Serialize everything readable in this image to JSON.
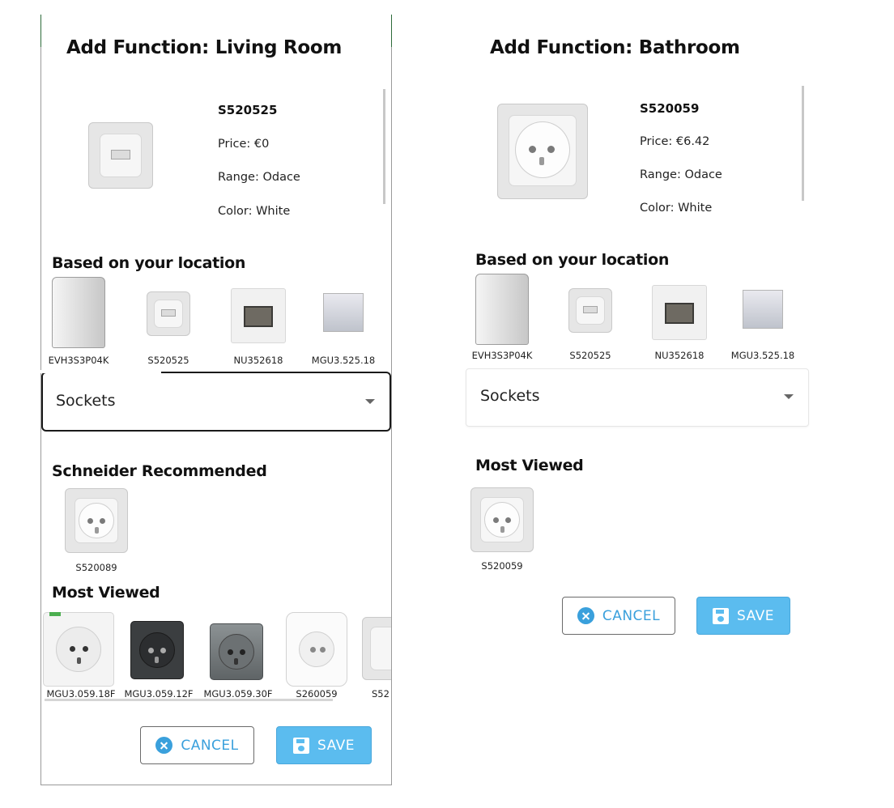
{
  "left": {
    "title": "Add Function: Living Room",
    "product": {
      "code": "S520525",
      "price": "Price: €0",
      "range": "Range: Odace",
      "color": "Color: White"
    },
    "location_heading": "Based on your location",
    "location_items": [
      "EVH3S3P04K",
      "S520525",
      "NU352618",
      "MGU3.525.18"
    ],
    "dropdown_value": "Sockets",
    "recommended_heading": "Schneider Recommended",
    "recommended_items": [
      "S520089"
    ],
    "most_viewed_heading": "Most Viewed",
    "most_viewed_items": [
      "MGU3.059.18F",
      "MGU3.059.12F",
      "MGU3.059.30F",
      "S260059",
      "S52"
    ],
    "cancel_label": "CANCEL",
    "save_label": "SAVE"
  },
  "right": {
    "title": "Add Function: Bathroom",
    "product": {
      "code": "S520059",
      "price": "Price: €6.42",
      "range": "Range: Odace",
      "color": "Color: White"
    },
    "location_heading": "Based on your location",
    "location_items": [
      "EVH3S3P04K",
      "S520525",
      "NU352618",
      "MGU3.525.18"
    ],
    "dropdown_value": "Sockets",
    "most_viewed_heading": "Most Viewed",
    "most_viewed_items": [
      "S520059"
    ],
    "cancel_label": "CANCEL",
    "save_label": "SAVE"
  },
  "colors": {
    "accent": "#3aa0dc",
    "save_button": "#5bbcef",
    "dialog_border": "#9a9a9a"
  },
  "icons": {
    "cancel": "close-circle-icon",
    "save": "floppy-disk-icon",
    "dropdown": "caret-down-icon"
  }
}
